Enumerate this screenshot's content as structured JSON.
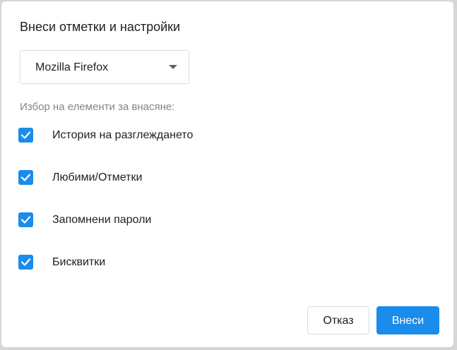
{
  "dialog": {
    "title": "Внеси отметки и настройки",
    "browser_select": {
      "selected": "Mozilla Firefox"
    },
    "section_label": "Избор на елементи за внасяне:",
    "items": [
      {
        "label": "История на разглеждането",
        "checked": true
      },
      {
        "label": "Любими/Отметки",
        "checked": true
      },
      {
        "label": "Запомнени пароли",
        "checked": true
      },
      {
        "label": "Бисквитки",
        "checked": true
      }
    ],
    "buttons": {
      "cancel_label": "Отказ",
      "import_label": "Внеси"
    }
  },
  "colors": {
    "accent": "#1a8ceb",
    "muted_text": "#80868b",
    "border": "#dadce0"
  },
  "icons": {
    "checkbox": "checkmark-icon",
    "dropdown": "chevron-down-icon"
  }
}
